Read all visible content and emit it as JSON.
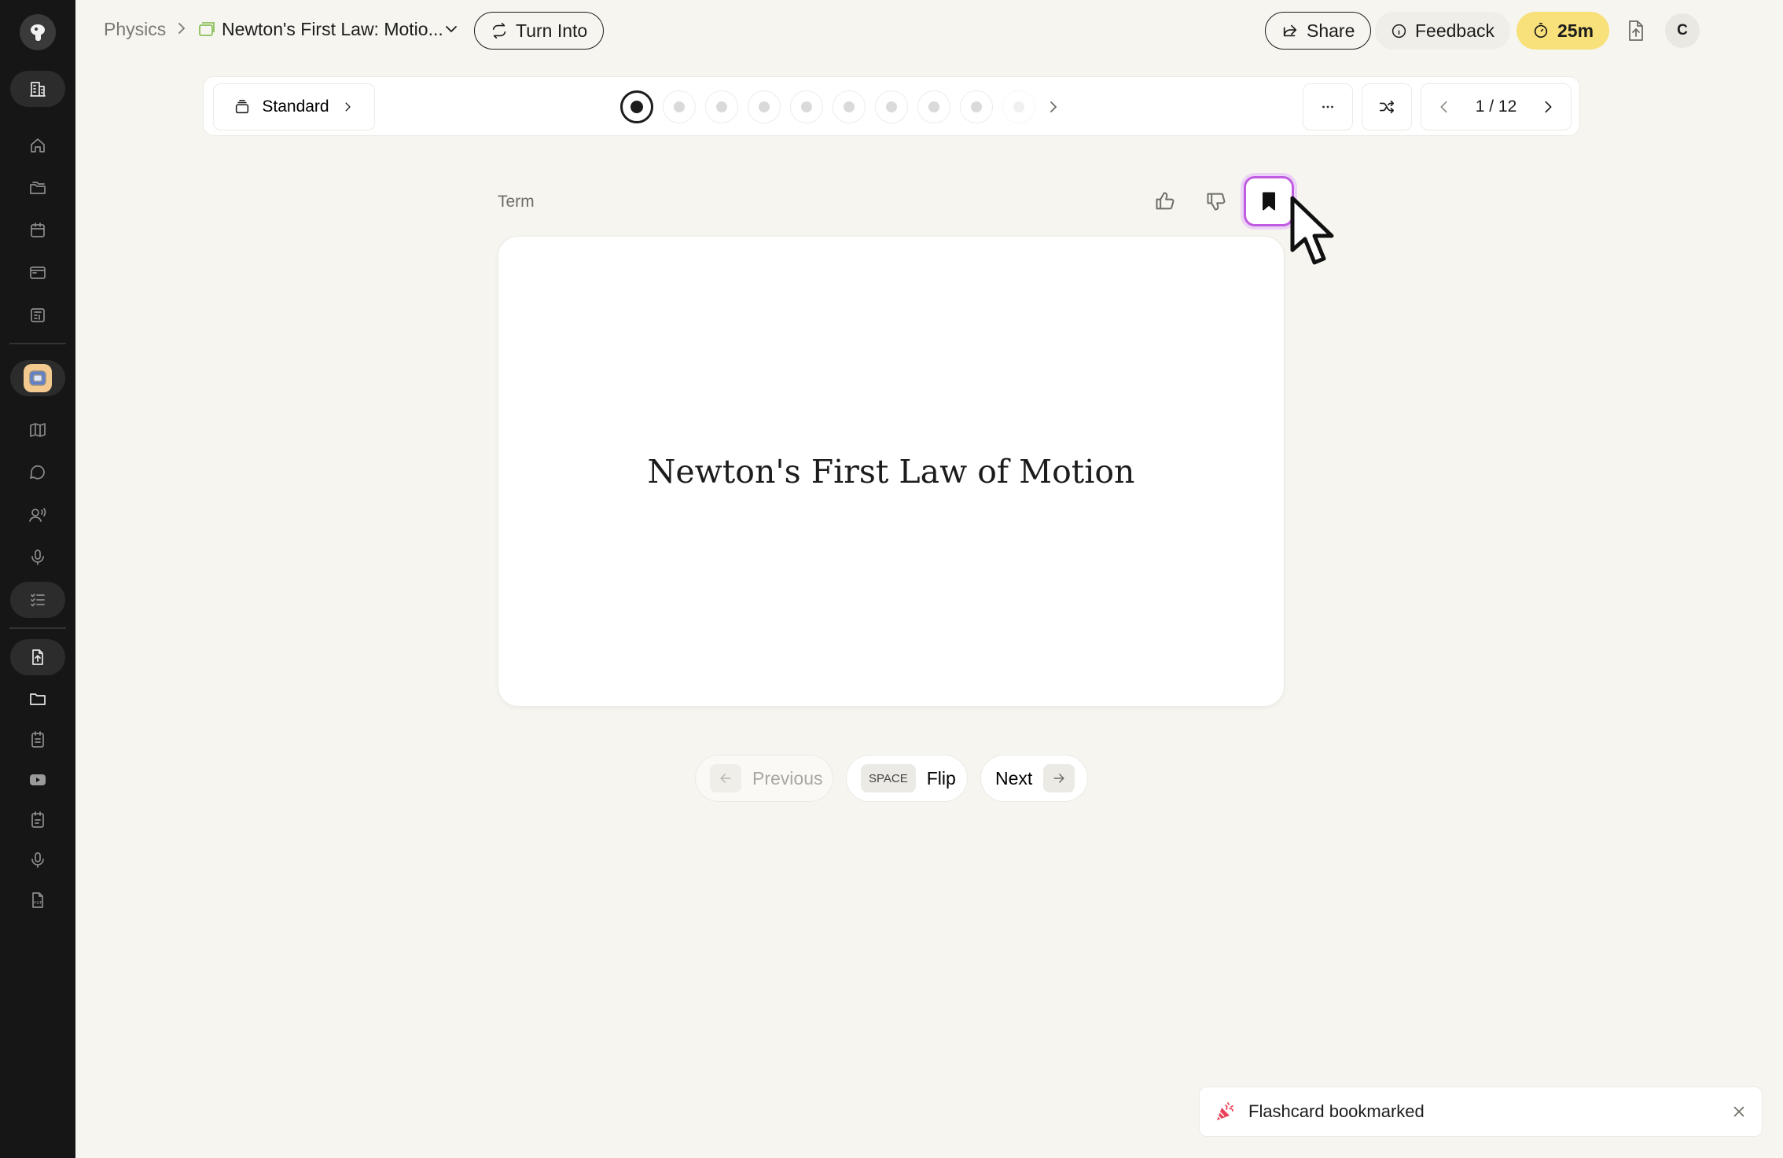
{
  "breadcrumb": {
    "parent": "Physics",
    "title": "Newton's First Law: Motio..."
  },
  "header": {
    "turn_into_label": "Turn Into",
    "share_label": "Share",
    "feedback_label": "Feedback",
    "timer_label": "25m",
    "avatar_initial": "C"
  },
  "toolbar": {
    "mode_label": "Standard",
    "more_label": "···",
    "page_indicator": "1 / 12",
    "current_card": 1,
    "total_cards": 12
  },
  "card": {
    "side_label": "Term",
    "text": "Newton's First Law of Motion",
    "bookmarked": true
  },
  "controls": {
    "previous_label": "Previous",
    "flip_key": "SPACE",
    "flip_label": "Flip",
    "next_label": "Next"
  },
  "toast": {
    "message": "Flashcard bookmarked"
  },
  "colors": {
    "background": "#f6f5ef",
    "sidebar": "#161616",
    "timer": "#f8e07a",
    "bookmark_highlight": "#c05ce0",
    "space_icon": "#f3c98f"
  },
  "icons": {
    "sidebar": [
      "logo-icon",
      "building-icon",
      "home-icon",
      "folders-icon",
      "calendar-icon",
      "browser-icon",
      "library-icon",
      "space-icon",
      "map-icon",
      "chat-icon",
      "voice-chat-icon",
      "mic-icon",
      "checklist-icon",
      "upload-file-icon",
      "folder-icon",
      "notes-icon",
      "youtube-icon",
      "document-icon",
      "audio-icon",
      "pdf-icon"
    ]
  }
}
